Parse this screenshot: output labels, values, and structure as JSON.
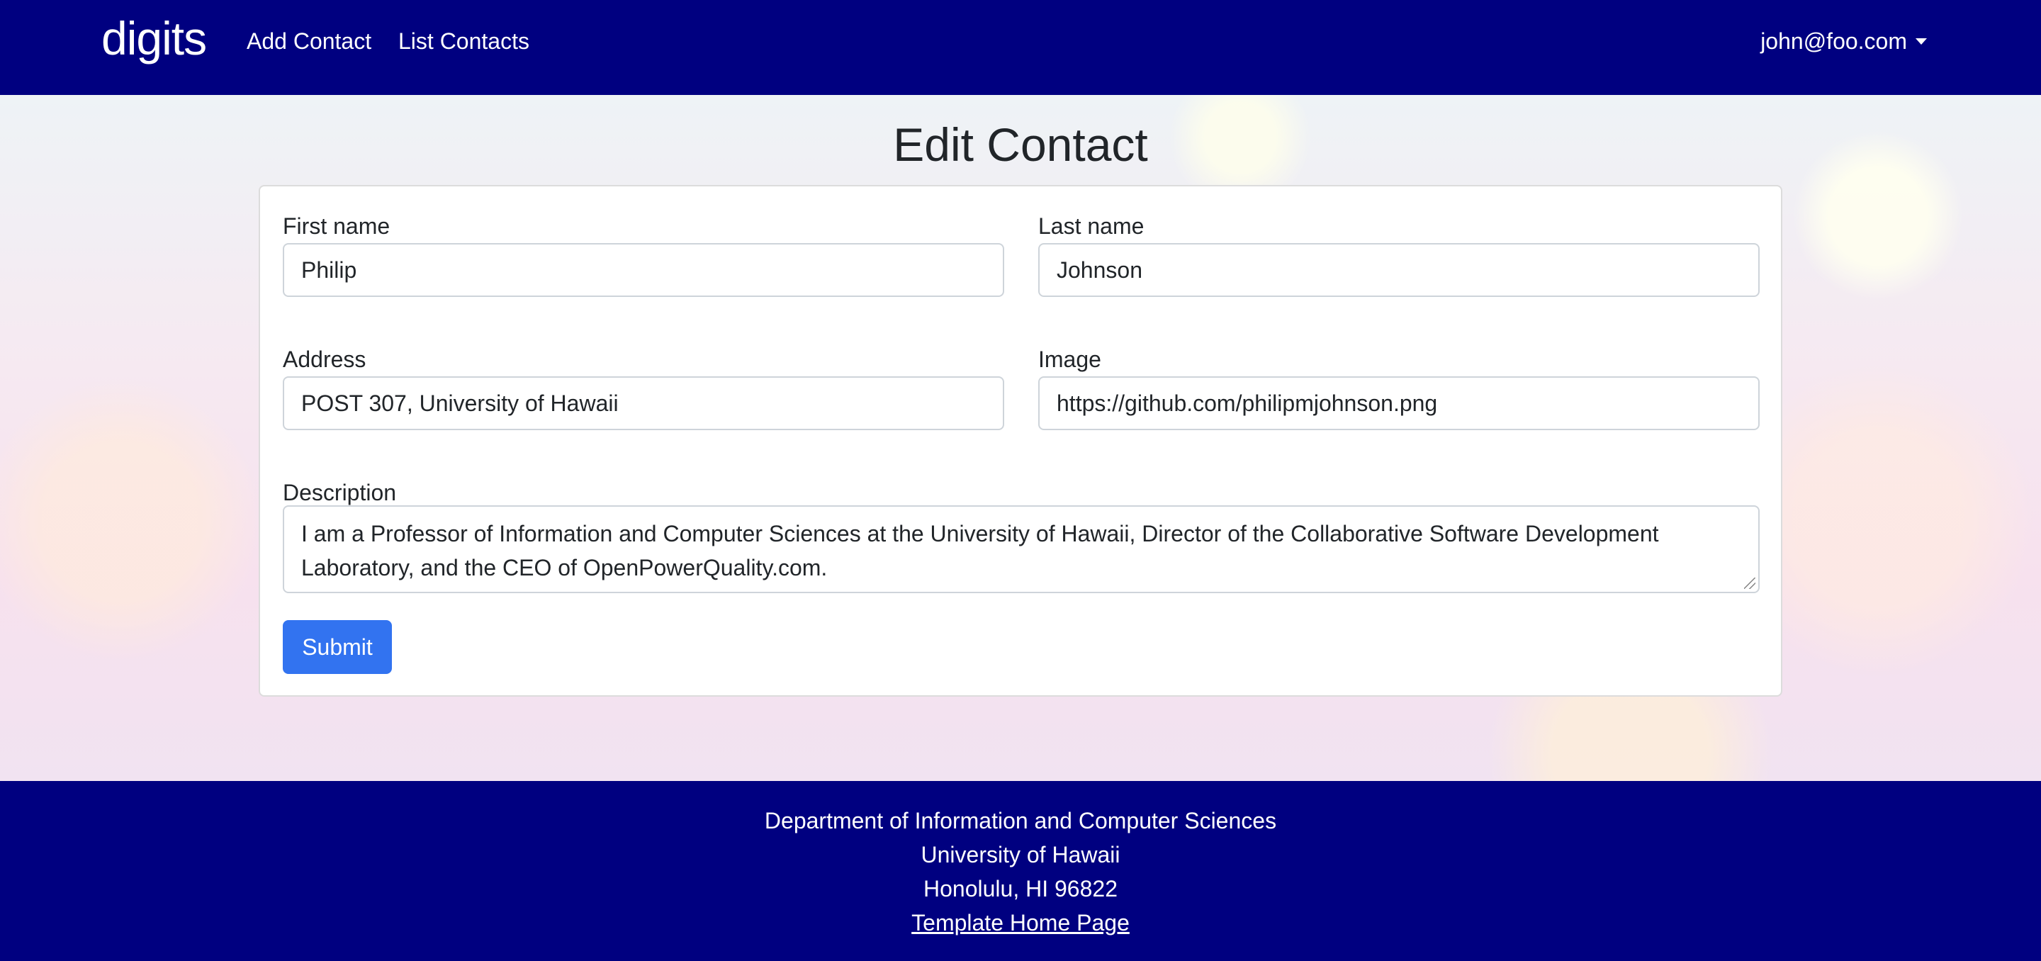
{
  "navbar": {
    "brand": "digits",
    "links": [
      "Add Contact",
      "List Contacts"
    ],
    "user": "john@foo.com"
  },
  "page": {
    "title": "Edit Contact"
  },
  "form": {
    "first_name": {
      "label": "First name",
      "value": "Philip"
    },
    "last_name": {
      "label": "Last name",
      "value": "Johnson"
    },
    "address": {
      "label": "Address",
      "value": "POST 307, University of Hawaii"
    },
    "image": {
      "label": "Image",
      "value": "https://github.com/philipmjohnson.png"
    },
    "description": {
      "label": "Description",
      "value": "I am a Professor of Information and Computer Sciences at the University of Hawaii, Director of the Collaborative Software Development Laboratory, and the CEO of OpenPowerQuality.com."
    },
    "submit_label": "Submit"
  },
  "footer": {
    "line1": "Department of Information and Computer Sciences",
    "line2": "University of Hawaii",
    "line3": "Honolulu, HI 96822",
    "link": "Template Home Page"
  },
  "colors": {
    "navbar_bg": "#000080",
    "button_bg": "#3273f0"
  }
}
